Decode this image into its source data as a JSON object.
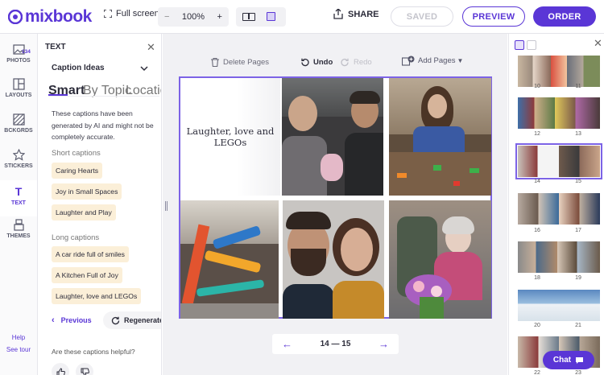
{
  "brand": {
    "name": "mixbook",
    "accent": "#5a36d6"
  },
  "toolbar": {
    "fullscreen_label": "Full screen",
    "zoom_minus": "−",
    "zoom_value": "100%",
    "zoom_plus": "+",
    "share_label": "SHARE",
    "saved_label": "SAVED",
    "preview_label": "PREVIEW",
    "order_label": "ORDER"
  },
  "leftnav": {
    "items": [
      {
        "label": "PHOTOS",
        "badge": "134",
        "icon": "photo-icon"
      },
      {
        "label": "LAYOUTS",
        "icon": "layout-icon"
      },
      {
        "label": "BCKGRDS",
        "icon": "background-icon"
      },
      {
        "label": "STICKERS",
        "icon": "star-icon"
      },
      {
        "label": "TEXT",
        "icon": "text-icon",
        "active": true
      },
      {
        "label": "THEMES",
        "icon": "theme-icon"
      }
    ],
    "help": "Help",
    "tour": "See tour"
  },
  "panel": {
    "title": "TEXT",
    "section_title": "Caption Ideas",
    "tabs": [
      "Smart",
      "By Topic",
      "Location"
    ],
    "description": "These captions have been generated by AI and might not be completely accurate.",
    "short_heading": "Short captions",
    "short_captions": [
      "Caring Hearts",
      "Joy in Small Spaces",
      "Laughter and Play"
    ],
    "long_heading": "Long captions",
    "long_captions": [
      "A car ride full of smiles",
      "A Kitchen Full of Joy",
      "Laughter, love and LEGOs"
    ],
    "previous_label": "Previous",
    "regenerate_label": "Regenerate",
    "helpful_question": "Are these captions helpful?"
  },
  "canvas": {
    "delete_label": "Delete Pages",
    "undo_label": "Undo",
    "redo_label": "Redo",
    "add_pages_label": "Add Pages",
    "spread_text": "Laughter, love and LEGOs",
    "pager_label": "14 — 15"
  },
  "rightbar": {
    "page_labels": [
      [
        "10",
        "11"
      ],
      [
        "12",
        "13"
      ],
      [
        "14",
        "15"
      ],
      [
        "16",
        "17"
      ],
      [
        "18",
        "19"
      ],
      [
        "20",
        "21"
      ],
      [
        "22",
        "23"
      ]
    ]
  },
  "chat_label": "Chat"
}
